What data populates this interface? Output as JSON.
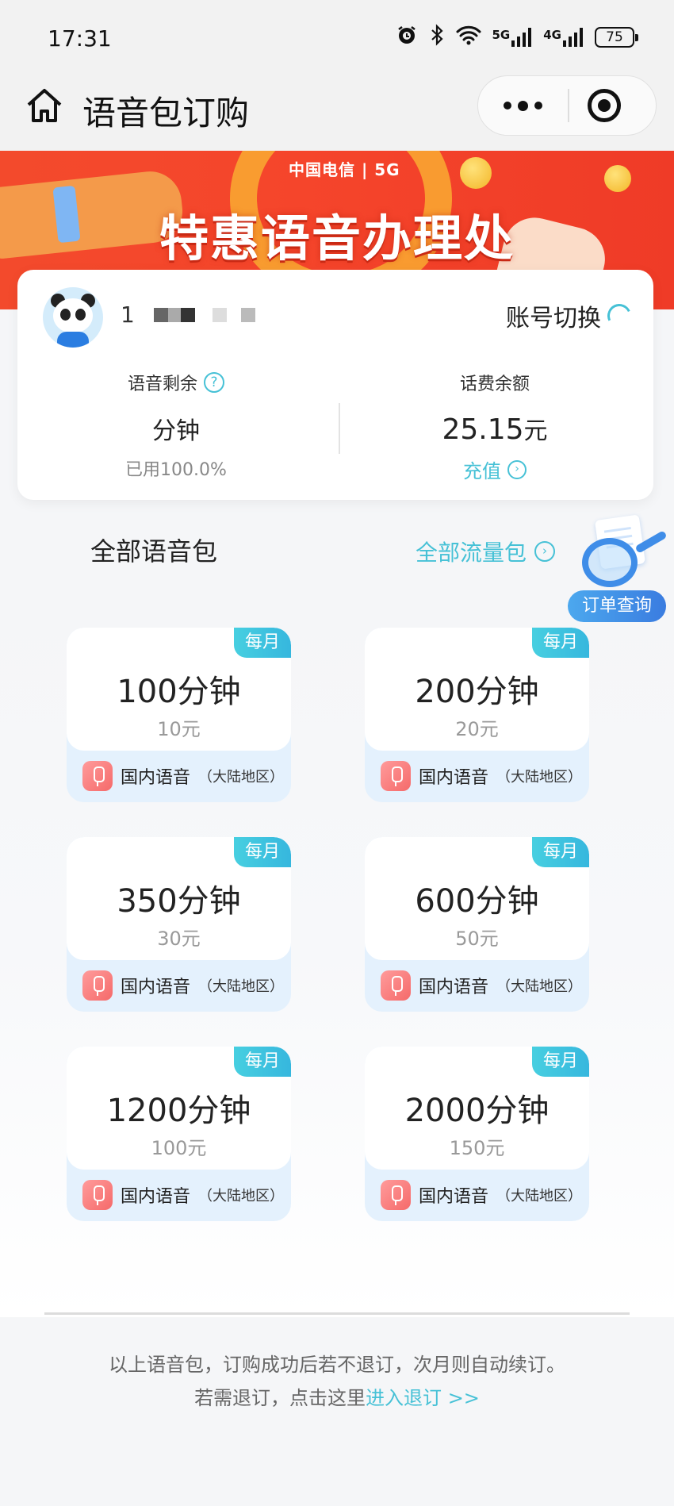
{
  "status_bar": {
    "time": "17:31",
    "icons": [
      "alarm-icon",
      "bluetooth-icon",
      "wifi-icon",
      "5g-signal-icon",
      "4g-signal-icon"
    ],
    "network_5g": "5G",
    "network_4g": "4G",
    "battery": "75"
  },
  "nav": {
    "title": "语音包订购",
    "home_icon": "home-icon"
  },
  "banner": {
    "brand": "中国电信 | 5G",
    "title": "特惠语音办理处"
  },
  "account": {
    "phone_prefix": "1",
    "switch_label": "账号切换",
    "voice_remaining_label": "语音剩余",
    "voice_remaining_value": "分钟",
    "voice_used": "已用100.0%",
    "balance_label": "话费余额",
    "balance_number": "25.15",
    "balance_unit": "元",
    "recharge_label": "充值"
  },
  "section": {
    "title": "全部语音包",
    "flow_link": "全部流量包",
    "order_query": "订单查询"
  },
  "packages": [
    {
      "minutes": "100分钟",
      "price": "10元",
      "badge": "每月",
      "type": "国内语音",
      "region": "（大陆地区）"
    },
    {
      "minutes": "200分钟",
      "price": "20元",
      "badge": "每月",
      "type": "国内语音",
      "region": "（大陆地区）"
    },
    {
      "minutes": "350分钟",
      "price": "30元",
      "badge": "每月",
      "type": "国内语音",
      "region": "（大陆地区）"
    },
    {
      "minutes": "600分钟",
      "price": "50元",
      "badge": "每月",
      "type": "国内语音",
      "region": "（大陆地区）"
    },
    {
      "minutes": "1200分钟",
      "price": "100元",
      "badge": "每月",
      "type": "国内语音",
      "region": "（大陆地区）"
    },
    {
      "minutes": "2000分钟",
      "price": "150元",
      "badge": "每月",
      "type": "国内语音",
      "region": "（大陆地区）"
    }
  ],
  "notice": {
    "line1": "以上语音包，订购成功后若不退订，次月则自动续订。",
    "line2_prefix": "若需退订，点击这里",
    "line2_link": "进入退订 >>"
  },
  "colors": {
    "accent": "#46c1d6",
    "banner_red": "#f34a2c",
    "badge": "#36b7de",
    "card_foot": "#e4f1fd"
  }
}
